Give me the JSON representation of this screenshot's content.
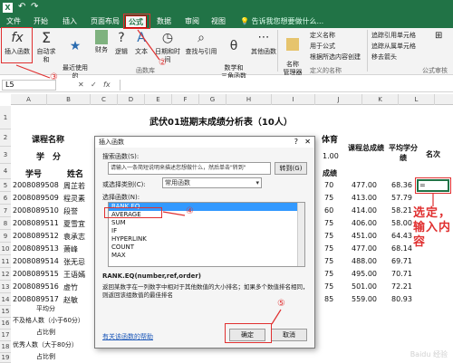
{
  "titlebar": {
    "file_icon": "excel-icon",
    "undo": "↶",
    "redo": "↷"
  },
  "ribbon_tabs": [
    "文件",
    "开始",
    "插入",
    "页面布局",
    "公式",
    "数据",
    "审阅",
    "视图"
  ],
  "tell_me": "告诉我您想要做什么...",
  "ribbon": {
    "insert_function": "插入函数",
    "autosum": "自动求和",
    "recent": "最近使用的\n函数",
    "financial": "财务",
    "logical": "逻辑",
    "text": "文本",
    "datetime": "日期和时间",
    "lookup": "查找与引用",
    "math": "数学和\n三角函数",
    "more": "其他函数",
    "name_manager": "名称\n管理器",
    "define_name": "定义名称",
    "use_in_formula": "用于公式",
    "create_from_sel": "根据所选内容创建",
    "trace_prec": "追踪引用单元格",
    "trace_dep": "追踪从属单元格",
    "remove_arrows": "移去箭头",
    "group_library": "函数库",
    "group_defined": "定义的名称",
    "group_audit": "公式审核"
  },
  "formula_bar": {
    "namebox": "L5",
    "fx": "fx"
  },
  "columns": [
    "A",
    "B",
    "C",
    "D",
    "E",
    "F",
    "G",
    "H",
    "I",
    "J",
    "K",
    "L"
  ],
  "sheet": {
    "title": "武伏01班期末成绩分析表（10人）",
    "h_course": "课程名称",
    "h_credit": "学　分",
    "h_id": "学号",
    "h_name": "姓名",
    "h_pe": "体育",
    "h_pe_credit": "1.00",
    "h_pe_score": "成绩",
    "h_total": "课程总成绩",
    "h_avg": "平均学分绩",
    "h_rank": "名次",
    "rows": [
      {
        "id": "2008089508",
        "name": "周芷若",
        "pe": "70",
        "total": "477.00",
        "avg": "68.36",
        "rank": "="
      },
      {
        "id": "2008089509",
        "name": "程灵素",
        "pe": "75",
        "total": "413.00",
        "avg": "57.79",
        "rank": ""
      },
      {
        "id": "2008089510",
        "name": "段誉",
        "pe": "60",
        "total": "414.00",
        "avg": "58.21",
        "rank": ""
      },
      {
        "id": "2008089511",
        "name": "夏雪宜",
        "pe": "75",
        "total": "406.00",
        "avg": "58.00",
        "rank": ""
      },
      {
        "id": "2008089512",
        "name": "袁承志",
        "pe": "75",
        "total": "451.00",
        "avg": "64.43",
        "rank": ""
      },
      {
        "id": "2008089513",
        "name": "萧峰",
        "pe": "75",
        "total": "477.00",
        "avg": "68.14",
        "rank": ""
      },
      {
        "id": "2008089514",
        "name": "张无忌",
        "pe": "75",
        "total": "488.00",
        "avg": "69.71",
        "rank": ""
      },
      {
        "id": "2008089515",
        "name": "王语嫣",
        "pe": "75",
        "total": "495.00",
        "avg": "70.71",
        "rank": ""
      },
      {
        "id": "2008089516",
        "name": "虚竹",
        "pe": "75",
        "total": "501.00",
        "avg": "72.21",
        "rank": ""
      },
      {
        "id": "2008089517",
        "name": "赵敏",
        "pe": "85",
        "total": "559.00",
        "avg": "80.93",
        "rank": ""
      }
    ],
    "avg_label": "平均分",
    "fail_label": "不及格人数（小于60分）",
    "ratio_label1": "占比例",
    "excellent_label": "优秀人数（大于80分）",
    "ratio_label2": "占比例"
  },
  "dialog": {
    "title": "插入函数",
    "search_label": "搜索函数(S):",
    "search_value": "请输入一条简短说明来描述您想做什么，然后单击\"转到\"",
    "goto": "转到(G)",
    "category_label": "或选择类别(C):",
    "category_value": "常用函数",
    "select_label": "选择函数(N):",
    "functions": [
      "RANK.EQ",
      "AVERAGE",
      "SUM",
      "IF",
      "HYPERLINK",
      "COUNT",
      "MAX"
    ],
    "signature": "RANK.EQ(number,ref,order)",
    "description": "返回某数字在一列数字中相对于其他数值的大小排名；如果多个数值排名相同，则返回该组数值的最佳排名",
    "help": "有关该函数的帮助",
    "ok": "确定",
    "cancel": "取消"
  },
  "annotations": {
    "n1": "①",
    "n2": "②",
    "n3": "③",
    "n4": "④",
    "n5": "⑤",
    "note": "选定，输入内容"
  },
  "watermark": "Baidu 经验",
  "colors": {
    "excel_green": "#217346",
    "red": "#e03030",
    "select_blue": "#3399ff"
  }
}
